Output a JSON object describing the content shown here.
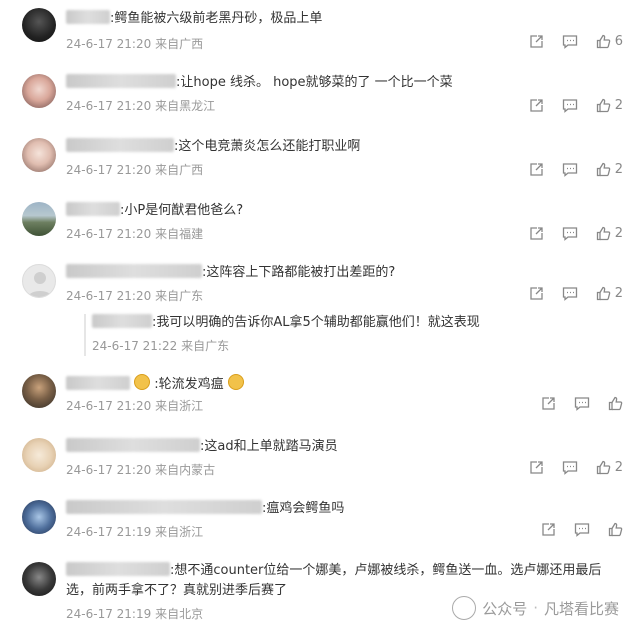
{
  "comments": [
    {
      "text": ":鳄鱼能被六级前老黑丹砂，极品上单",
      "time": "24-6-17 21:20",
      "location": "来自广西",
      "likes": "6"
    },
    {
      "text": ":让hope 线杀。 hope就够菜的了 一个比一个菜",
      "time": "24-6-17 21:20",
      "location": "来自黑龙江",
      "likes": "2"
    },
    {
      "text": ":这个电竞萧炎怎么还能打职业啊",
      "time": "24-6-17 21:20",
      "location": "来自广西",
      "likes": "2"
    },
    {
      "text": ":小P是何猷君他爸么?",
      "time": "24-6-17 21:20",
      "location": "来自福建",
      "likes": "2"
    },
    {
      "text": ":这阵容上下路都能被打出差距的?",
      "time": "24-6-17 21:20",
      "location": "来自广东",
      "likes": "2"
    },
    {
      "text": ":轮流发鸡瘟",
      "time": "24-6-17 21:20",
      "location": "来自浙江",
      "likes": ""
    },
    {
      "text": ":这ad和上单就踏马演员",
      "time": "24-6-17 21:20",
      "location": "来自内蒙古",
      "likes": "2"
    },
    {
      "text": ":瘟鸡会鳄鱼吗",
      "time": "24-6-17 21:19",
      "location": "来自浙江",
      "likes": ""
    },
    {
      "text": ":想不通counter位给一个娜美，卢娜被线杀，鳄鱼送一血。选卢娜还用最后",
      "text2": "选，前两手拿不了？真就别进季后赛了",
      "time": "24-6-17 21:19",
      "location": "来自北京",
      "likes": ""
    }
  ],
  "reply": {
    "text": ":我可以明确的告诉你AL拿5个辅助都能赢他们！就这表现",
    "time": "24-6-17 21:22",
    "location": "来自广东"
  },
  "watermark": {
    "prefix": "公众号",
    "dot": "·",
    "name": "凡塔看比赛"
  },
  "colors": {
    "meta": "#999999",
    "text": "#333333",
    "icon": "#888888"
  }
}
